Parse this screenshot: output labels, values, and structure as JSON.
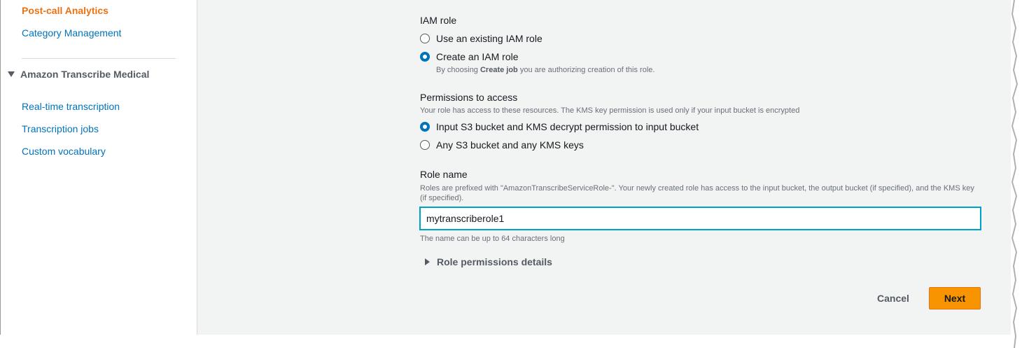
{
  "sidebar": {
    "items_top": [
      {
        "label": "Post-call Analytics"
      },
      {
        "label": "Category Management"
      }
    ],
    "section_title": "Amazon Transcribe Medical",
    "section_items": [
      {
        "label": "Real-time transcription"
      },
      {
        "label": "Transcription jobs"
      },
      {
        "label": "Custom vocabulary"
      }
    ]
  },
  "iam_role": {
    "label": "IAM role",
    "options": [
      {
        "label": "Use an existing IAM role",
        "selected": false
      },
      {
        "label": "Create an IAM role",
        "selected": true
      }
    ],
    "hint_prefix": "By choosing ",
    "hint_bold": "Create job",
    "hint_suffix": " you are authorizing creation of this role."
  },
  "permissions": {
    "label": "Permissions to access",
    "description": "Your role has access to these resources. The KMS key permission is used only if your input bucket is encrypted",
    "options": [
      {
        "label": "Input S3 bucket and KMS decrypt permission to input bucket",
        "selected": true
      },
      {
        "label": "Any S3 bucket and any KMS keys",
        "selected": false
      }
    ]
  },
  "role_name": {
    "label": "Role name",
    "description": "Roles are prefixed with \"AmazonTranscribeServiceRole-\". Your newly created role has access to the input bucket, the output bucket (if specified), and the KMS key (if specified).",
    "value": "mytranscriberole1",
    "constraint": "The name can be up to 64 characters long"
  },
  "expander": {
    "label": "Role permissions details"
  },
  "actions": {
    "cancel_label": "Cancel",
    "next_label": "Next"
  },
  "colors": {
    "link": "#0073bb",
    "active_link": "#ec7211",
    "primary_button": "#f79400",
    "radio_selected": "#0073bb",
    "input_focus": "#00a1c9"
  }
}
